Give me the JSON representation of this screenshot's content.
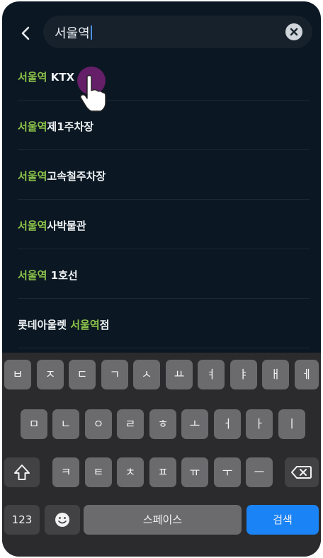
{
  "search": {
    "back_icon": "chevron-left-icon",
    "query": "서울역",
    "clear_icon": "clear-circle-icon"
  },
  "suggestions": [
    {
      "before": "",
      "highlight": "서울역",
      "after": " KTX"
    },
    {
      "before": "",
      "highlight": "서울역",
      "after": "제1주차장"
    },
    {
      "before": "",
      "highlight": "서울역",
      "after": "고속철주차장"
    },
    {
      "before": "",
      "highlight": "서울역",
      "after": "사박물관"
    },
    {
      "before": "",
      "highlight": "서울역",
      "after": " 1호선"
    },
    {
      "before": "롯데아울렛 ",
      "highlight": "서울역",
      "after": "점"
    }
  ],
  "keyboard": {
    "row1": [
      "ㅂ",
      "ㅈ",
      "ㄷ",
      "ㄱ",
      "ㅅ",
      "ㅛ",
      "ㅕ",
      "ㅑ",
      "ㅐ",
      "ㅔ"
    ],
    "row2": [
      "ㅁ",
      "ㄴ",
      "ㅇ",
      "ㄹ",
      "ㅎ",
      "ㅗ",
      "ㅓ",
      "ㅏ",
      "ㅣ"
    ],
    "row3": [
      "ㅋ",
      "ㅌ",
      "ㅊ",
      "ㅍ",
      "ㅠ",
      "ㅜ",
      "ㅡ"
    ],
    "shift_icon": "shift-icon",
    "backspace_icon": "backspace-icon",
    "numbers_label": "123",
    "emoji_icon": "emoji-icon",
    "space_label": "스페이스",
    "search_label": "검색"
  },
  "colors": {
    "background": "#0b1722",
    "highlight": "#8bc34a",
    "search_key": "#1a83f5"
  }
}
